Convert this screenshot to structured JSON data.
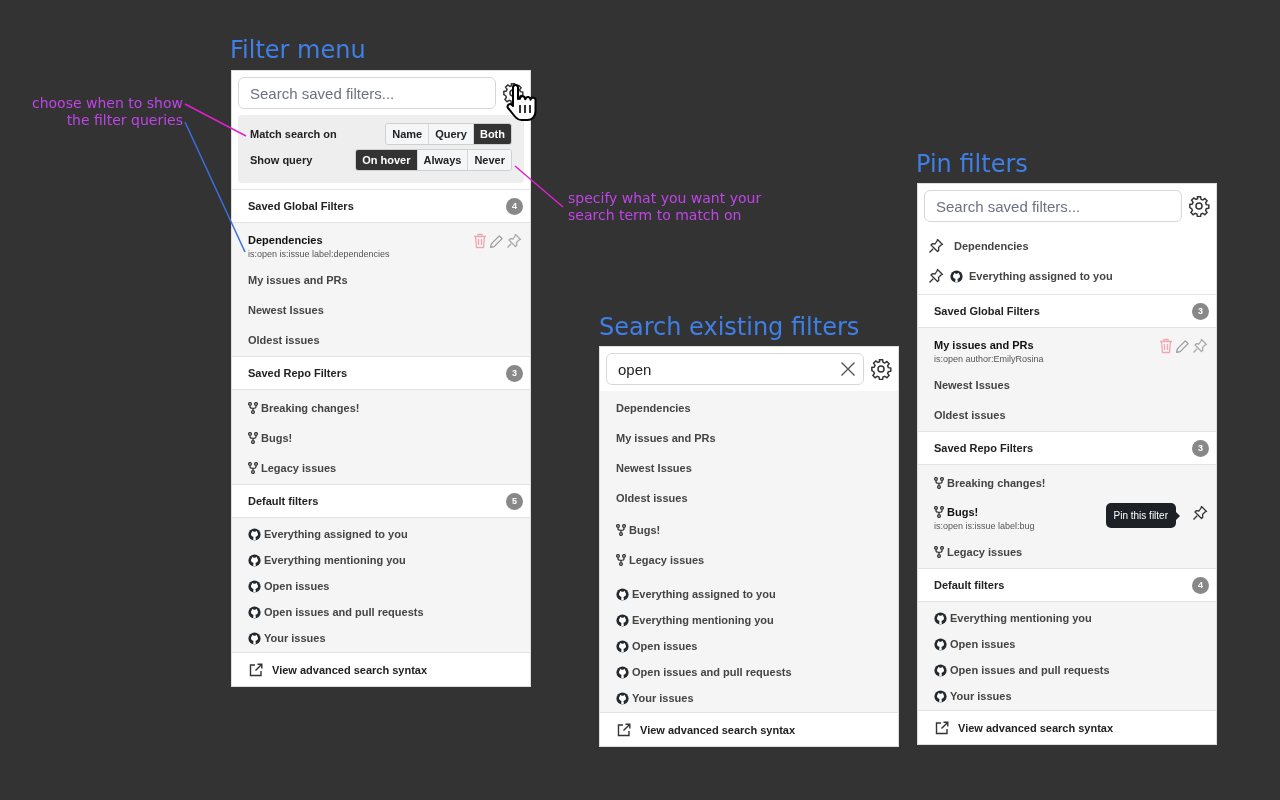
{
  "panels": [
    {
      "title": "Filter menu",
      "search": {
        "placeholder": "Search saved filters..."
      },
      "pointer_on_settings": true,
      "settings": {
        "rows": [
          {
            "label": "Match search on",
            "options": [
              {
                "label": "Name",
                "selected": false
              },
              {
                "label": "Query",
                "selected": false
              },
              {
                "label": "Both",
                "selected": true
              }
            ]
          },
          {
            "label": "Show query",
            "options": [
              {
                "label": "On hover",
                "selected": true
              },
              {
                "label": "Always",
                "selected": false
              },
              {
                "label": "Never",
                "selected": false
              }
            ]
          }
        ]
      },
      "sections": [
        {
          "title": "Saved Global Filters",
          "count": "4",
          "items": [
            {
              "label": "Dependencies",
              "kind": "plain",
              "highlighted": true,
              "query": "is:open is:issue label:dependencies",
              "actions": [
                {
                  "kind": "delete"
                },
                {
                  "kind": "edit"
                },
                {
                  "kind": "pin"
                }
              ]
            },
            {
              "label": "My issues and PRs",
              "kind": "plain",
              "highlighted": false
            },
            {
              "label": "Newest Issues",
              "kind": "plain",
              "highlighted": false
            },
            {
              "label": "Oldest issues",
              "kind": "plain",
              "highlighted": false
            }
          ]
        },
        {
          "title": "Saved Repo Filters",
          "count": "3",
          "items": [
            {
              "label": "Breaking changes!",
              "kind": "fork",
              "highlighted": false
            },
            {
              "label": "Bugs!",
              "kind": "fork",
              "highlighted": false
            },
            {
              "label": "Legacy issues",
              "kind": "fork",
              "highlighted": false
            }
          ]
        },
        {
          "title": "Default filters",
          "count": "5",
          "items": [
            {
              "label": "Everything assigned to you",
              "kind": "logo",
              "highlighted": false
            },
            {
              "label": "Everything mentioning you",
              "kind": "logo",
              "highlighted": false
            },
            {
              "label": "Open issues",
              "kind": "logo",
              "highlighted": false
            },
            {
              "label": "Open issues and pull requests",
              "kind": "logo",
              "highlighted": false
            },
            {
              "label": "Your issues",
              "kind": "logo",
              "highlighted": false
            }
          ]
        }
      ],
      "footer": "View advanced search syntax"
    },
    {
      "title": "Search existing filters",
      "search": {
        "value": "open"
      },
      "pointer_on_settings": false,
      "sections": [
        {
          "items": [
            {
              "label": "Dependencies",
              "kind": "plain",
              "highlighted": false
            },
            {
              "label": "My issues and PRs",
              "kind": "plain",
              "highlighted": false
            },
            {
              "label": "Newest Issues",
              "kind": "plain",
              "highlighted": false
            },
            {
              "label": "Oldest issues",
              "kind": "plain",
              "highlighted": false
            }
          ]
        },
        {
          "items": [
            {
              "label": "Bugs!",
              "kind": "fork",
              "highlighted": false
            },
            {
              "label": "Legacy issues",
              "kind": "fork",
              "highlighted": false
            }
          ]
        },
        {
          "items": [
            {
              "label": "Everything assigned to you",
              "kind": "logo",
              "highlighted": false
            },
            {
              "label": "Everything mentioning you",
              "kind": "logo",
              "highlighted": false
            },
            {
              "label": "Open issues",
              "kind": "logo",
              "highlighted": false
            },
            {
              "label": "Open issues and pull requests",
              "kind": "logo",
              "highlighted": false
            },
            {
              "label": "Your issues",
              "kind": "logo",
              "highlighted": false
            }
          ]
        }
      ],
      "footer": "View advanced search syntax"
    },
    {
      "title": "Pin filters",
      "search": {
        "placeholder": "Search saved filters..."
      },
      "pointer_on_settings": false,
      "pinned": [
        {
          "label": "Dependencies",
          "kind": "plain"
        },
        {
          "label": "Everything assigned to you",
          "kind": "logo"
        }
      ],
      "sections": [
        {
          "title": "Saved Global Filters",
          "count": "3",
          "items": [
            {
              "label": "My issues and PRs",
              "kind": "plain",
              "highlighted": true,
              "query": "is:open author:EmilyRosina",
              "actions": [
                {
                  "kind": "delete"
                },
                {
                  "kind": "edit"
                },
                {
                  "kind": "pin"
                }
              ]
            },
            {
              "label": "Newest Issues",
              "kind": "plain",
              "highlighted": false
            },
            {
              "label": "Oldest issues",
              "kind": "plain",
              "highlighted": false
            }
          ]
        },
        {
          "title": "Saved Repo Filters",
          "count": "3",
          "items": [
            {
              "label": "Breaking changes!",
              "kind": "fork",
              "highlighted": false
            },
            {
              "label": "Bugs!",
              "kind": "fork",
              "highlighted": true,
              "query": "is:open is:issue label:bug",
              "actions": [
                {
                  "kind": "pin"
                }
              ],
              "tooltip": "Pin this filter"
            },
            {
              "label": "Legacy issues",
              "kind": "fork",
              "highlighted": false
            }
          ]
        },
        {
          "title": "Default filters",
          "count": "4",
          "items": [
            {
              "label": "Everything mentioning you",
              "kind": "logo",
              "highlighted": false
            },
            {
              "label": "Open issues",
              "kind": "logo",
              "highlighted": false
            },
            {
              "label": "Open issues and pull requests",
              "kind": "logo",
              "highlighted": false
            },
            {
              "label": "Your issues",
              "kind": "logo",
              "highlighted": false
            }
          ]
        }
      ],
      "footer": "View advanced search syntax"
    }
  ],
  "annotations": [
    {
      "text": "choose when to show the filter queries"
    },
    {
      "text": "specify what you want your search term to match on"
    }
  ]
}
